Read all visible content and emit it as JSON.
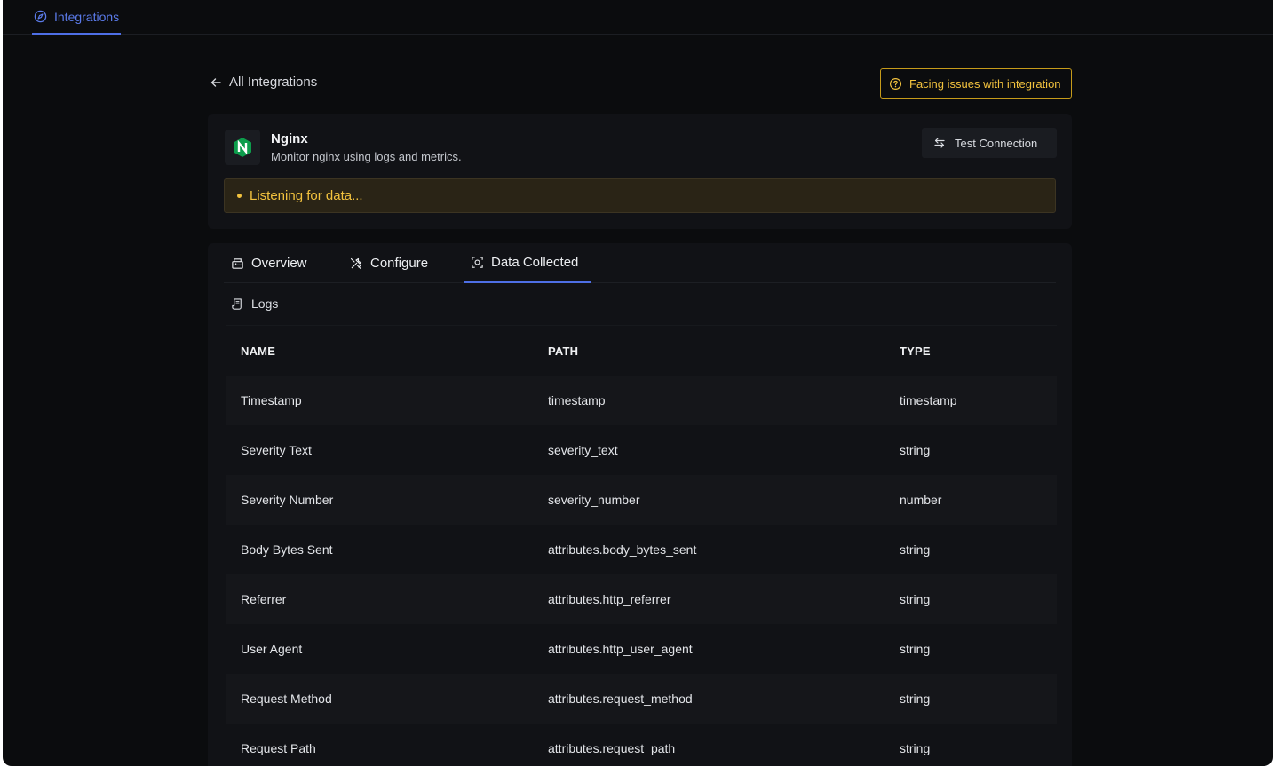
{
  "topbar": {
    "tab_label": "Integrations"
  },
  "header": {
    "back_label": "All Integrations",
    "issues_label": "Facing issues with integration"
  },
  "integration": {
    "name": "Nginx",
    "description": "Monitor nginx using logs and metrics.",
    "logo_letter": "N",
    "test_button_label": "Test Connection",
    "status_text": "Listening for data..."
  },
  "tabs": [
    {
      "label": "Overview",
      "icon": "overview-icon"
    },
    {
      "label": "Configure",
      "icon": "configure-icon"
    },
    {
      "label": "Data Collected",
      "icon": "data-collected-icon",
      "active": true
    }
  ],
  "section": {
    "logs_label": "Logs"
  },
  "table": {
    "headers": [
      "NAME",
      "PATH",
      "TYPE"
    ],
    "rows": [
      [
        "Timestamp",
        "timestamp",
        "timestamp"
      ],
      [
        "Severity Text",
        "severity_text",
        "string"
      ],
      [
        "Severity Number",
        "severity_number",
        "number"
      ],
      [
        "Body Bytes Sent",
        "attributes.body_bytes_sent",
        "string"
      ],
      [
        "Referrer",
        "attributes.http_referrer",
        "string"
      ],
      [
        "User Agent",
        "attributes.http_user_agent",
        "string"
      ],
      [
        "Request Method",
        "attributes.request_method",
        "string"
      ],
      [
        "Request Path",
        "attributes.request_path",
        "string"
      ]
    ]
  },
  "colors": {
    "accent": "#4e6fe6",
    "warning": "#f2c23e",
    "background": "#0b0c0e",
    "card": "#111216",
    "nginx_green": "#0d9d4c"
  }
}
